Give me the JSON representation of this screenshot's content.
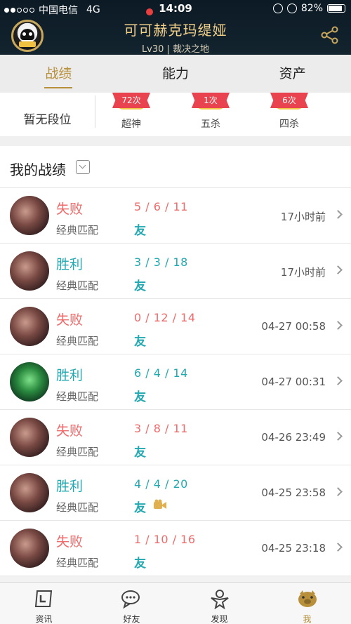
{
  "status": {
    "carrier": "中国电信",
    "network": "4G",
    "time": "14:09",
    "battery": "82%"
  },
  "header": {
    "name": "可可赫克玛缇娅",
    "subtitle": "Lv30 | 裁决之地"
  },
  "tabs": [
    {
      "label": "战绩",
      "active": true
    },
    {
      "label": "能力",
      "active": false
    },
    {
      "label": "资产",
      "active": false
    }
  ],
  "rank": {
    "label": "暂无段位",
    "badges": [
      {
        "count": "72次",
        "name": "超神"
      },
      {
        "count": "1次",
        "name": "五杀"
      },
      {
        "count": "6次",
        "name": "四杀"
      }
    ]
  },
  "section": {
    "title": "我的战绩"
  },
  "matches": [
    {
      "result": "失败",
      "mode": "经典匹配",
      "kda": "5 / 6 / 11",
      "friend": "友",
      "time": "17小时前",
      "win": false,
      "hero": "red",
      "cam": false
    },
    {
      "result": "胜利",
      "mode": "经典匹配",
      "kda": "3 / 3 / 18",
      "friend": "友",
      "time": "17小时前",
      "win": true,
      "hero": "red",
      "cam": false
    },
    {
      "result": "失败",
      "mode": "经典匹配",
      "kda": "0 / 12 / 14",
      "friend": "友",
      "time": "04-27 00:58",
      "win": false,
      "hero": "red",
      "cam": false
    },
    {
      "result": "胜利",
      "mode": "经典匹配",
      "kda": "6 / 4 / 14",
      "friend": "友",
      "time": "04-27 00:31",
      "win": true,
      "hero": "green",
      "cam": false
    },
    {
      "result": "失败",
      "mode": "经典匹配",
      "kda": "3 / 8 / 11",
      "friend": "友",
      "time": "04-26 23:49",
      "win": false,
      "hero": "red",
      "cam": false
    },
    {
      "result": "胜利",
      "mode": "经典匹配",
      "kda": "4 / 4 / 20",
      "friend": "友",
      "time": "04-25 23:58",
      "win": true,
      "hero": "red",
      "cam": true
    },
    {
      "result": "失败",
      "mode": "经典匹配",
      "kda": "1 / 10 / 16",
      "friend": "友",
      "time": "04-25 23:18",
      "win": false,
      "hero": "red",
      "cam": false
    }
  ],
  "nav": [
    {
      "label": "资讯",
      "icon": "news-icon",
      "active": false
    },
    {
      "label": "好友",
      "icon": "chat-bubble-icon",
      "active": false
    },
    {
      "label": "发现",
      "icon": "discover-icon",
      "active": false
    },
    {
      "label": "我",
      "icon": "profile-pig-icon",
      "active": true
    }
  ],
  "colors": {
    "accent": "#b8903c",
    "win": "#22a8b0",
    "lose": "#ef6a6a"
  }
}
